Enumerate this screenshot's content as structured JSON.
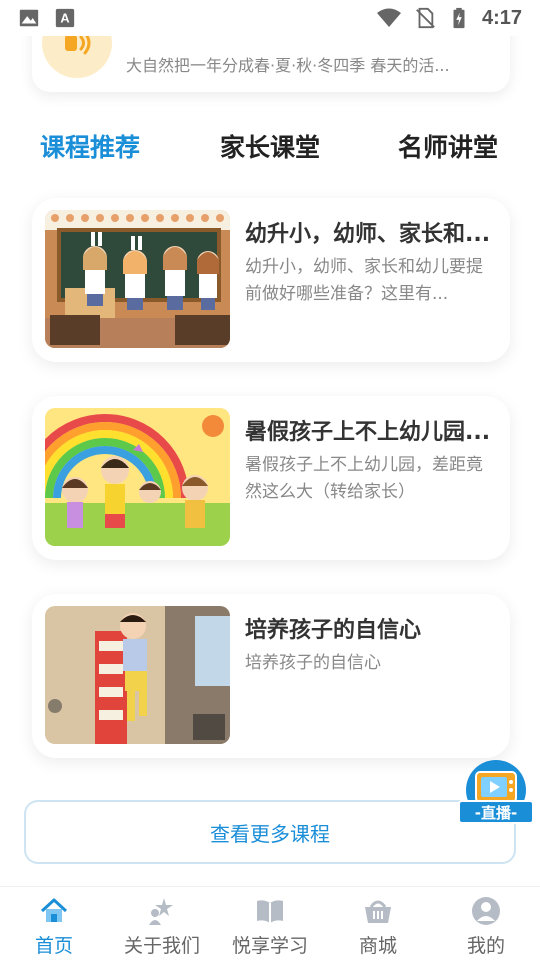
{
  "status_bar": {
    "time": "4:17",
    "icons": [
      "image-icon",
      "text-a-icon",
      "wifi-icon",
      "no-sim-icon",
      "battery-icon"
    ]
  },
  "audio_card": {
    "icon": "speaker-icon",
    "description": "大自然把一年分成春·夏·秋·冬四季 春天的活..."
  },
  "tabs": [
    {
      "label": "课程推荐",
      "active": true
    },
    {
      "label": "家长课堂",
      "active": false
    },
    {
      "label": "名师讲堂",
      "active": false
    }
  ],
  "courses": [
    {
      "title": "幼升小，幼师、家长和...",
      "description": "幼升小，幼师、家长和幼儿要提前做好哪些准备？这里有..."
    },
    {
      "title": "暑假孩子上不上幼儿园...",
      "description": "暑假孩子上不上幼儿园，差距竟然这么大（转给家长）"
    },
    {
      "title": "培养孩子的自信心",
      "description": "培养孩子的自信心"
    }
  ],
  "more_button": {
    "label": "查看更多课程"
  },
  "live_button": {
    "label": "-直播-"
  },
  "bottom_nav": [
    {
      "label": "首页",
      "icon": "home-icon",
      "active": true
    },
    {
      "label": "关于我们",
      "icon": "star-person-icon",
      "active": false
    },
    {
      "label": "悦享学习",
      "icon": "book-icon",
      "active": false
    },
    {
      "label": "商城",
      "icon": "basket-icon",
      "active": false
    },
    {
      "label": "我的",
      "icon": "user-icon",
      "active": false
    }
  ],
  "colors": {
    "accent": "#1b8ed8",
    "text_primary": "#333333",
    "text_secondary": "#888888"
  }
}
